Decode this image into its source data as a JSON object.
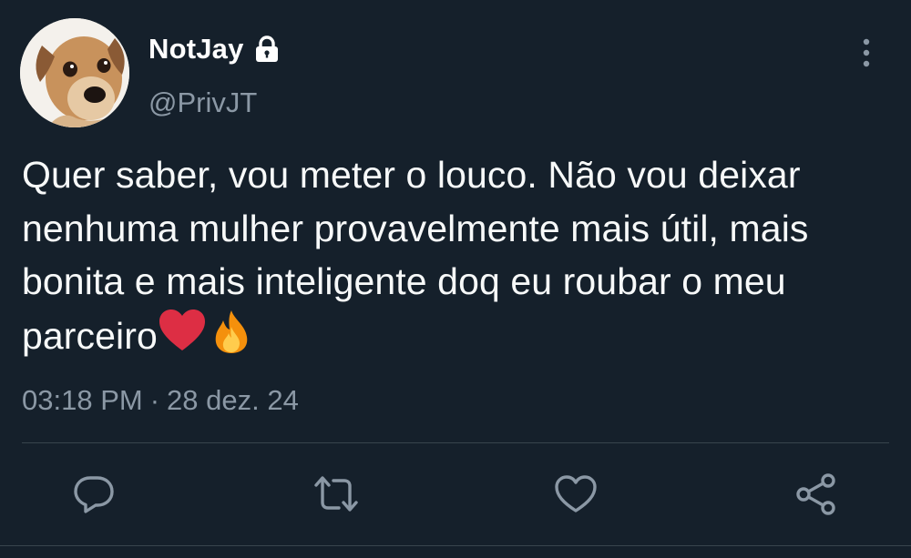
{
  "tweet": {
    "display_name": "NotJay",
    "handle": "@PrivJT",
    "text": "Quer saber, vou meter o louco. Não vou deixar nenhuma mulher provavelmente mais útil, mais bonita e mais inteligente doq eu roubar o meu parceiro",
    "emojis": [
      "❤️",
      "🔥"
    ],
    "time": "03:18 PM",
    "date": "28 dez. 24",
    "icons": {
      "verified_status": "lock-icon",
      "menu": "more-vertical-icon",
      "reply": "reply-icon",
      "retweet": "retweet-icon",
      "like": "heart-icon",
      "share": "share-icon"
    }
  },
  "colors": {
    "background": "#15202b",
    "text_primary": "#f7f9f9",
    "text_secondary": "#8b98a5",
    "divider": "#38444d",
    "icon": "#8b98a5"
  }
}
